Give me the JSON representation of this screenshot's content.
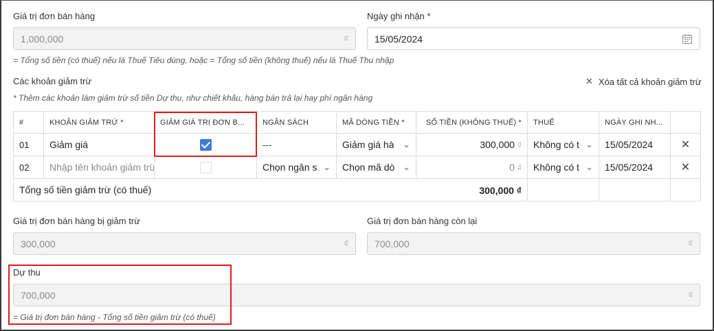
{
  "order_value": {
    "label": "Giá trị đơn bán hàng",
    "value": "1,000,000",
    "currency": "₫"
  },
  "record_date": {
    "label": "Ngày ghi nhận *",
    "value": "15/05/2024"
  },
  "order_hint": "= Tổng số tiền (có thuế) nếu là Thuế Tiêu dùng, hoặc = Tổng số tiền (không thuế) nếu là Thuế Thu nhập",
  "deductions": {
    "title": "Các khoản giảm trừ",
    "clear_all": "Xóa tất cả khoản giảm trừ",
    "hint": "* Thêm các khoản làm giảm trừ số tiền Dự thu, như chiết khấu, hàng bán trả lại hay phí ngân hàng",
    "columns": [
      "#",
      "Khoản giảm trừ *",
      "Giảm giá trị đơn b...",
      "Ngân sách",
      "Mã dòng tiền *",
      "Số tiền (không thuế) *",
      "Thuế",
      "Ngày ghi nh..."
    ],
    "rows": [
      {
        "no": "01",
        "name": "Giảm giá",
        "checked": true,
        "budget": "---",
        "cashflow": "Giảm giá hà",
        "amount": "300,000",
        "tax": "Không có t",
        "date": "15/05/2024"
      },
      {
        "no": "02",
        "name": "Nhập tên khoản giảm trừ",
        "checked": false,
        "budget": "Chọn ngân s",
        "cashflow": "Chọn mã dò",
        "amount": "0",
        "tax": "Không có t",
        "date": "15/05/2024"
      }
    ],
    "total_label": "Tổng số tiền giảm trừ (có thuế)",
    "total_value": "300,000 ₫"
  },
  "reduced_value": {
    "label": "Giá trị đơn bán hàng bị giảm trừ",
    "value": "300,000",
    "currency": "₫"
  },
  "remaining_value": {
    "label": "Giá trị đơn bán hàng còn lại",
    "value": "700,000",
    "currency": "₫"
  },
  "expected_revenue": {
    "label": "Dự thu",
    "value": "700,000",
    "currency": "₫",
    "hint": "= Giá trị đơn bán hàng - Tổng số tiền giảm trừ (có thuế)"
  },
  "currency_small": "₫",
  "colors": {
    "highlight": "#e01b1b",
    "checkbox": "#3b7dd8"
  }
}
